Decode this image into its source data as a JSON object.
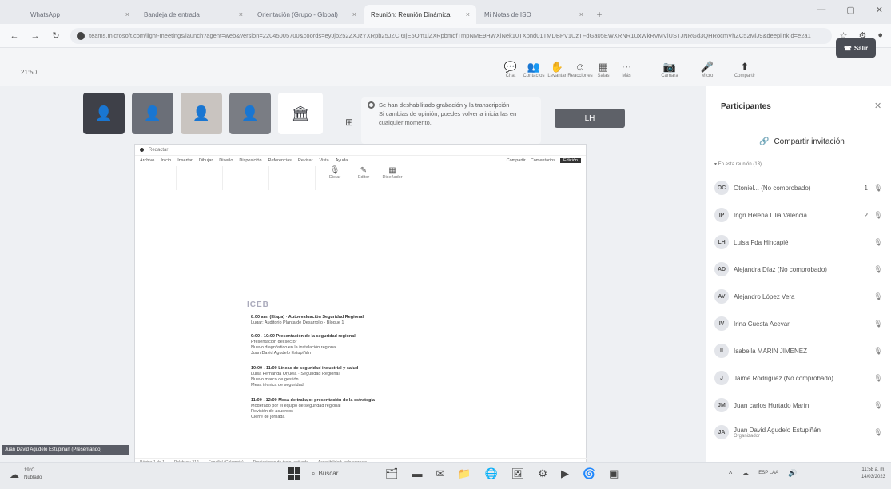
{
  "browser": {
    "tabs": [
      {
        "label": "WhatsApp",
        "active": false
      },
      {
        "label": "Bandeja de entrada",
        "active": false
      },
      {
        "label": "Orientación (Grupo - Global)",
        "active": false
      },
      {
        "label": "Reunión: Reunión Dinámica",
        "active": true
      },
      {
        "label": "Mi Notas de ISO",
        "active": false
      }
    ],
    "tab_close": "×",
    "tab_plus": "+",
    "window_controls": [
      "—",
      "▢",
      "✕"
    ],
    "url": "teams.microsoft.com/light-meetings/launch?agent=web&version=22045005700&coords=eyJjb252ZXJzYXRpb25JZCI6IjE5Om1lZXRpbmdfTmpNME9HWXlNek10TXpnd01TMDBPV1UzTFdGa05EWXRNR1UxWkRVMVlUSTJNRGd3QHRocmVhZC52MiJ9&deeplinkId=e2a1",
    "icons": {
      "back": "←",
      "forward": "→",
      "reload": "↻",
      "star": "☆",
      "ext": "⚙",
      "profile": "●"
    }
  },
  "meeting": {
    "timer": "21:50",
    "toolbar": [
      {
        "icon": "chat-icon",
        "glyph": "💬",
        "label": "Chat"
      },
      {
        "icon": "people-icon",
        "glyph": "👥",
        "label": "Contactos"
      },
      {
        "icon": "hand-icon",
        "glyph": "✋",
        "label": "Levantar"
      },
      {
        "icon": "reactions-icon",
        "glyph": "☺",
        "label": "Reacciones"
      },
      {
        "icon": "rooms-icon",
        "glyph": "▦",
        "label": "Salas"
      },
      {
        "icon": "more-icon",
        "glyph": "⋯",
        "label": "Más"
      }
    ],
    "devices": [
      {
        "icon": "camera-icon",
        "glyph": "📷",
        "label": "Cámara"
      },
      {
        "icon": "mic-icon",
        "glyph": "🎤",
        "label": "Micro"
      },
      {
        "icon": "share-icon",
        "glyph": "⬆",
        "label": "Compartir"
      }
    ],
    "leave_label": "Salir",
    "leave_icon": "☎",
    "thumbnail_glyphs": [
      "👤",
      "👤",
      "👤",
      "👤",
      "🏛"
    ],
    "lh_tile": "LH",
    "notice": {
      "title": "Se han deshabilitado grabación y la transcripción",
      "body": "Si cambias de opinión, puedes volver a iniciarlas en cualquier momento."
    },
    "presenter_label": "Juan David Agudelo Estupiñán (Presentando)"
  },
  "shared_doc": {
    "top": "Redactar",
    "menus": [
      "Archivo",
      "Inicio",
      "Insertar",
      "Dibujar",
      "Diseño",
      "Disposición",
      "Referencias",
      "Revisar",
      "Vista",
      "Ayuda"
    ],
    "modes": [
      "Compartir",
      "Comentarios",
      "Edición"
    ],
    "ribbon": [
      "Dictar",
      "Editor",
      "Diseñador"
    ],
    "logo": "ICEB",
    "sections": [
      {
        "title": "8:00 am. (Etapa) · Autoevaluación Seguridad Regional",
        "lines": [
          "Lugar: Auditorio Planta de Desarrollo - Bloque 1"
        ]
      },
      {
        "title": "9:00 - 10:00 Presentación de la seguridad regional",
        "lines": [
          "Presentación del sector",
          "Nuevo diagnóstico en la instalación regional",
          "Juan David Agudelo Estupiñán"
        ]
      },
      {
        "title": "10:00 - 11:00 Líneas de seguridad industrial y salud",
        "lines": [
          "Luisa Fernanda Orjuela · Seguridad Regional",
          "Nuevo marco de gestión",
          "Mesa técnica de seguridad"
        ]
      },
      {
        "title": "11:00 - 12:00 Mesa de trabajo: presentación de la estrategia",
        "lines": [
          "Moderado por el equipo de seguridad regional",
          "Revisión de acuerdos",
          "Cierre de jornada"
        ]
      }
    ],
    "status": [
      "Página 1 de 1",
      "Palabras: 312",
      "Español (Colombia)",
      "Predicciones de texto: activado",
      "Accesibilidad: todo correcto"
    ]
  },
  "participants": {
    "title": "Participantes",
    "close": "✕",
    "invite_label": "Compartir invitación",
    "invite_icon": "🔗",
    "section_label": "▾ En esta reunión (13)",
    "mic_glyph": "🎙",
    "list": [
      {
        "initials": "OC",
        "name": "Otoniel... (No comprobado)",
        "badge": "1"
      },
      {
        "initials": "IP",
        "name": "Ingri Helena Lilia Valencia",
        "badge": "2"
      },
      {
        "initials": "LH",
        "name": "Luisa Fda Hincapié",
        "badge": ""
      },
      {
        "initials": "AD",
        "name": "Alejandra Díaz (No comprobado)",
        "badge": ""
      },
      {
        "initials": "AV",
        "name": "Alejandro López Vera",
        "badge": ""
      },
      {
        "initials": "IV",
        "name": "Irina Cuesta Acevar",
        "badge": ""
      },
      {
        "initials": "II",
        "name": "Isabella MARÍN JIMÉNEZ",
        "badge": ""
      },
      {
        "initials": "J",
        "name": "Jaime Rodríguez (No comprobado)",
        "badge": ""
      },
      {
        "initials": "JM",
        "name": "Juan carlos Hurtado Marín",
        "badge": ""
      },
      {
        "initials": "JA",
        "name": "Juan David Agudelo Estupiñán",
        "role": "Organizador",
        "badge": ""
      }
    ]
  },
  "taskbar": {
    "weather_temp": "19°C",
    "weather_desc": "Nublado",
    "weather_glyph": "☁",
    "search": "Buscar",
    "search_icon": "⌕",
    "apps": [
      "🗂",
      "▬",
      "✉",
      "📁",
      "🌐",
      "🖼",
      "⚙",
      "▶",
      "🌀",
      "▣"
    ],
    "tray": [
      "^",
      "☁",
      "🔊"
    ],
    "lang": "ESP LAA",
    "time": "11:58 a. m.",
    "date": "14/03/2023"
  }
}
